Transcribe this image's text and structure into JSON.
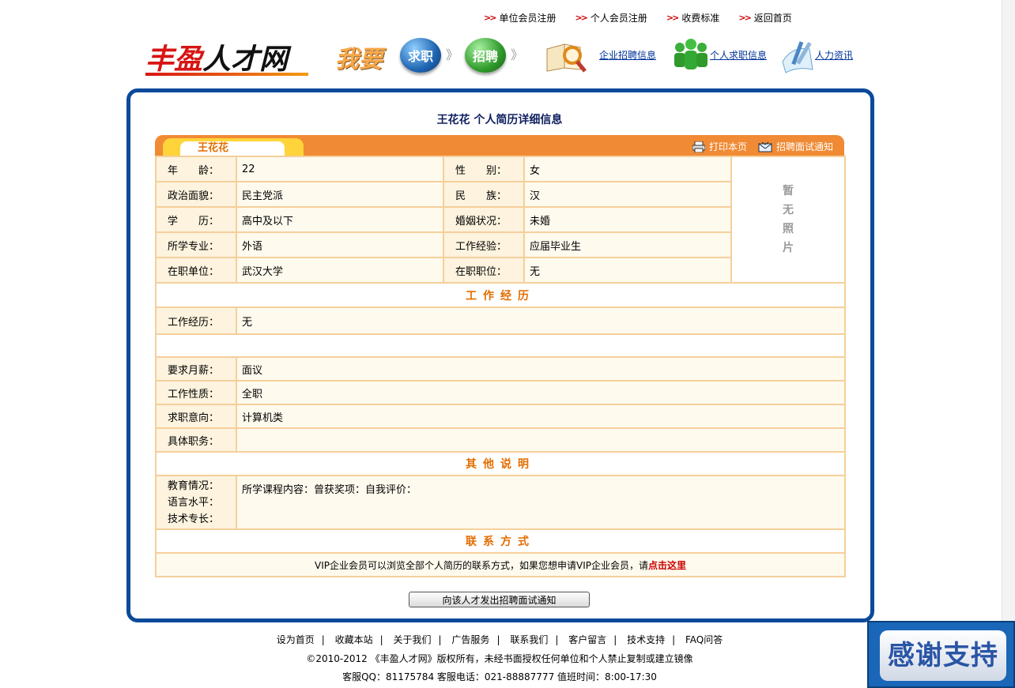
{
  "top_links": [
    "单位会员注册",
    "个人会员注册",
    "收费标准",
    "返回首页"
  ],
  "logo": {
    "part1": "丰盈",
    "part2": "人才网"
  },
  "header": {
    "iwant": "我要",
    "seek_job": "求职",
    "recruit": "招聘",
    "nav": [
      "企业招聘信息",
      "个人求职信息",
      "人力资讯"
    ]
  },
  "resume": {
    "title": "王花花  个人简历详细信息",
    "tab_name": "王花花",
    "print_label": "打印本页",
    "notify_label": "招聘面试通知",
    "photo_text": "暂\n无\n照\n片",
    "basic": [
      {
        "l1": "年　　龄：",
        "v1": "22",
        "l2": "性　　别：",
        "v2": "女"
      },
      {
        "l1": "政治面貌：",
        "v1": "民主党派",
        "l2": "民　　族：",
        "v2": "汉"
      },
      {
        "l1": "学　　历：",
        "v1": "高中及以下",
        "l2": "婚姻状况：",
        "v2": "未婚"
      },
      {
        "l1": "所学专业：",
        "v1": "外语",
        "l2": "工作经验：",
        "v2": "应届毕业生"
      },
      {
        "l1": "在职单位：",
        "v1": "武汉大学",
        "l2": "在职职位：",
        "v2": "无"
      }
    ],
    "sec_work": "工作经历",
    "work_label": "工作经历：",
    "work_value": "无",
    "salary_label": "要求月薪：",
    "salary_value": "面议",
    "nature_label": "工作性质：",
    "nature_value": "全职",
    "intent_label": "求职意向：",
    "intent_value": "计算机类",
    "duty_label": "具体职务：",
    "duty_value": "",
    "sec_other": "其他说明",
    "other_labels": [
      "教育情况：",
      "语言水平：",
      "技术专长："
    ],
    "other_value": "所学课程内容：曾获奖项：自我评价：",
    "sec_contact": "联系方式",
    "contact_text": "VIP企业会员可以浏览全部个人简历的联系方式，如果您想申请VIP企业会员，请",
    "contact_link": "点击这里",
    "send_button": "向该人才发出招聘面试通知"
  },
  "footer": {
    "links": [
      "设为首页",
      "收藏本站",
      "关于我们",
      "广告服务",
      "联系我们",
      "客户留言",
      "技术支持",
      "FAQ问答"
    ],
    "copyright": "©2010-2012 《丰盈人才网》版权所有，未经书面授权任何单位和个人禁止复制或建立镜像",
    "service": "客服QQ：81175784  客服电话：021-88887777  值班时间：8:00-17:30"
  },
  "thanks_badge": "感谢支持"
}
